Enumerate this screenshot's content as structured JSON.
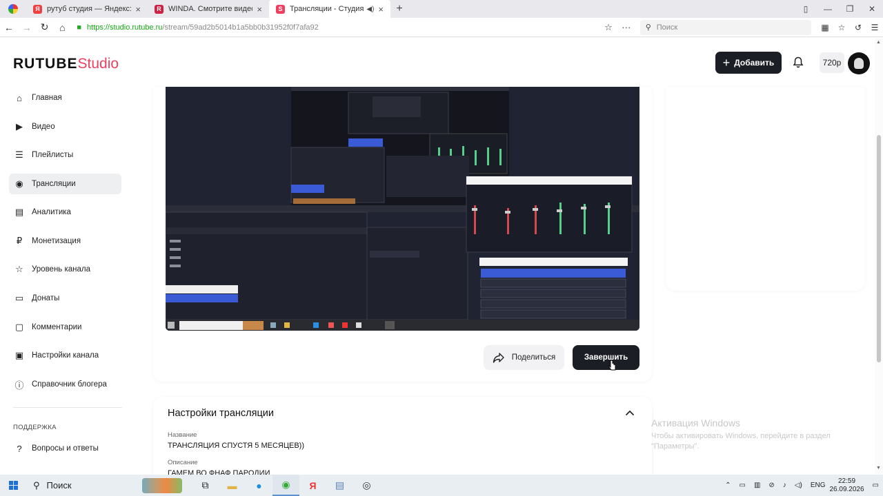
{
  "browser": {
    "tabs": [
      {
        "title": "рутуб студия — Яндекс: наш",
        "favicon_color": "#ef3f3f",
        "favicon_glyph": "Я"
      },
      {
        "title": "WINDA. Смотрите видео онл",
        "favicon_color": "#cc2244",
        "favicon_glyph": "R"
      },
      {
        "title": "Трансляции - Студия RUT",
        "favicon_color": "#ef3f61",
        "favicon_glyph": "S",
        "active": true
      }
    ],
    "new_tab": "+",
    "url_host": "https://studio.rutube.ru",
    "url_path": "/stream/59ad2b5014b1a5bb0b31952f0f7afa92",
    "search_placeholder": "Поиск"
  },
  "header": {
    "logo_main": "RUTUBE",
    "logo_accent": "Studio",
    "add_button": "Добавить",
    "quality": "720p"
  },
  "sidebar": {
    "items": [
      {
        "label": "Главная",
        "icon": "home-icon",
        "glyph": "⌂"
      },
      {
        "label": "Видео",
        "icon": "video-icon",
        "glyph": "▶"
      },
      {
        "label": "Плейлисты",
        "icon": "playlist-icon",
        "glyph": "☰"
      },
      {
        "label": "Трансляции",
        "icon": "broadcast-icon",
        "glyph": "◉",
        "active": true
      },
      {
        "label": "Аналитика",
        "icon": "analytics-icon",
        "glyph": "▤"
      },
      {
        "label": "Монетизация",
        "icon": "monetization-icon",
        "glyph": "₽"
      },
      {
        "label": "Уровень канала",
        "icon": "star-icon",
        "glyph": "☆"
      },
      {
        "label": "Донаты",
        "icon": "donate-icon",
        "glyph": "▭"
      },
      {
        "label": "Комментарии",
        "icon": "comments-icon",
        "glyph": "▢"
      },
      {
        "label": "Настройки канала",
        "icon": "settings-icon",
        "glyph": "▣"
      },
      {
        "label": "Справочник блогера",
        "icon": "info-icon",
        "glyph": "ⓘ"
      }
    ],
    "section_label": "ПОДДЕРЖКА",
    "support_items": [
      {
        "label": "Вопросы и ответы",
        "icon": "help-icon",
        "glyph": "?"
      }
    ]
  },
  "player": {
    "share_button": "Поделиться",
    "finish_button": "Завершить"
  },
  "settings": {
    "title": "Настройки трансляции",
    "name_label": "Название",
    "name_value": "ТРАНСЛЯЦИЯ СПУСТЯ 5 МЕСЯЦЕВ))",
    "description_label": "Описание",
    "description_value": "ГАМЕМ ВО ФНАФ ПАРОДИИ"
  },
  "activation": {
    "title": "Активация Windows",
    "text": "Чтобы активировать Windows, перейдите в раздел \"Параметры\"."
  },
  "taskbar": {
    "search_label": "Поиск",
    "lang": "ENG",
    "time": "22:59",
    "date": "26.09.2026"
  }
}
